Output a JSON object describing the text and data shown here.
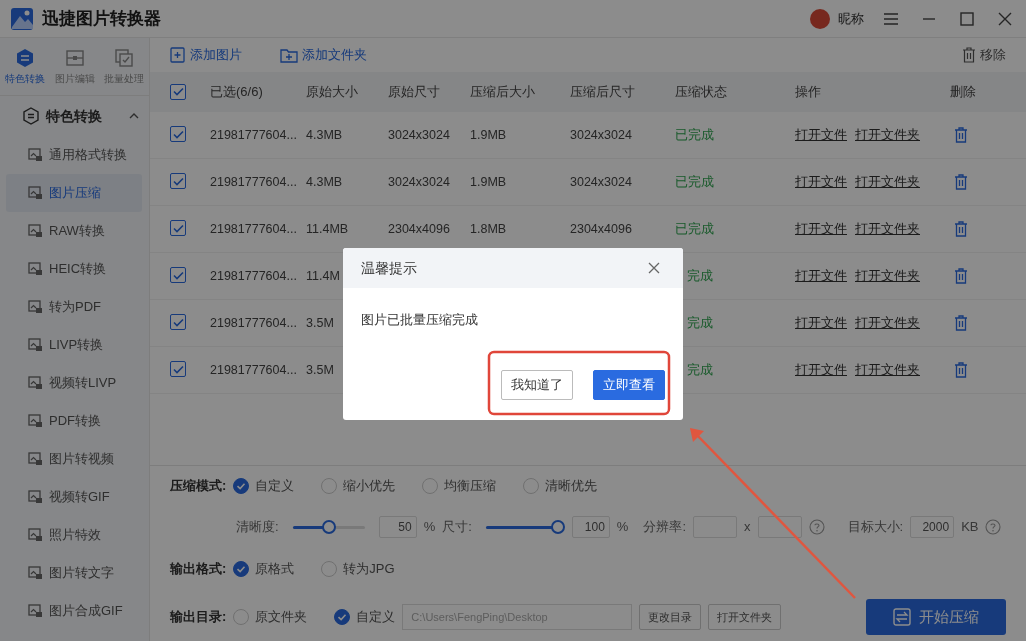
{
  "app": {
    "title": "迅捷图片转换器",
    "user": "昵称"
  },
  "top_tabs": [
    {
      "label": "特色转换",
      "selected": true
    },
    {
      "label": "图片编辑",
      "selected": false
    },
    {
      "label": "批量处理",
      "selected": false
    }
  ],
  "sidebar": {
    "group": {
      "label": "特色转换",
      "expanded": true
    },
    "items": [
      {
        "label": "通用格式转换",
        "selected": false
      },
      {
        "label": "图片压缩",
        "selected": true
      },
      {
        "label": "RAW转换",
        "selected": false
      },
      {
        "label": "HEIC转换",
        "selected": false
      },
      {
        "label": "转为PDF",
        "selected": false
      },
      {
        "label": "LIVP转换",
        "selected": false
      },
      {
        "label": "视频转LIVP",
        "selected": false
      },
      {
        "label": "PDF转换",
        "selected": false
      },
      {
        "label": "图片转视频",
        "selected": false
      },
      {
        "label": "视频转GIF",
        "selected": false
      },
      {
        "label": "照片特效",
        "selected": false
      },
      {
        "label": "图片转文字",
        "selected": false
      },
      {
        "label": "图片合成GIF",
        "selected": false
      }
    ]
  },
  "toolbar": {
    "add_image": "添加图片",
    "add_folder": "添加文件夹",
    "remove": "移除"
  },
  "table": {
    "all_checked": true,
    "columns": [
      "已选(6/6)",
      "原始大小",
      "原始尺寸",
      "压缩后大小",
      "压缩后尺寸",
      "压缩状态",
      "操作",
      "删除"
    ],
    "rows": [
      {
        "checked": true,
        "name": "21981777604...",
        "orig_size": "4.3MB",
        "orig_dim": "3024x3024",
        "new_size": "1.9MB",
        "new_dim": "3024x3024",
        "status": "已完成",
        "actions": [
          "打开文件",
          "打开文件夹"
        ]
      },
      {
        "checked": true,
        "name": "21981777604...",
        "orig_size": "4.3MB",
        "orig_dim": "3024x3024",
        "new_size": "1.9MB",
        "new_dim": "3024x3024",
        "status": "已完成",
        "actions": [
          "打开文件",
          "打开文件夹"
        ]
      },
      {
        "checked": true,
        "name": "21981777604...",
        "orig_size": "11.4MB",
        "orig_dim": "2304x4096",
        "new_size": "1.8MB",
        "new_dim": "2304x4096",
        "status": "已完成",
        "actions": [
          "打开文件",
          "打开文件夹"
        ]
      },
      {
        "checked": true,
        "name": "21981777604...",
        "orig_size": "11.4M",
        "status": "完成",
        "actions": [
          "打开文件",
          "打开文件夹"
        ]
      },
      {
        "checked": true,
        "name": "21981777604...",
        "orig_size": "3.5M",
        "status": "完成",
        "actions": [
          "打开文件",
          "打开文件夹"
        ]
      },
      {
        "checked": true,
        "name": "21981777604...",
        "orig_size": "3.5M",
        "status": "完成",
        "actions": [
          "打开文件",
          "打开文件夹"
        ]
      }
    ]
  },
  "settings": {
    "mode": {
      "label": "压缩模式:",
      "options": [
        {
          "label": "自定义",
          "selected": true
        },
        {
          "label": "缩小优先",
          "selected": false
        },
        {
          "label": "均衡压缩",
          "selected": false
        },
        {
          "label": "清晰优先",
          "selected": false
        }
      ]
    },
    "quality": {
      "label": "清晰度:",
      "level": 0.5,
      "value": "50",
      "unit": "%"
    },
    "size": {
      "label": "尺寸:",
      "level": 1,
      "value": "100",
      "unit": "%"
    },
    "resolution": {
      "label": "分辨率:",
      "separator": "x"
    },
    "target": {
      "label": "目标大小:",
      "value": "2000",
      "unit": "KB"
    },
    "format": {
      "label": "输出格式:",
      "options": [
        {
          "label": "原格式",
          "selected": true
        },
        {
          "label": "转为JPG",
          "selected": false
        }
      ]
    },
    "output": {
      "label": "输出目录:",
      "options": [
        {
          "label": "原文件夹",
          "selected": false
        },
        {
          "label": "自定义",
          "selected": true
        }
      ],
      "path": "C:\\Users\\FengPing\\Desktop",
      "change": "更改目录",
      "open": "打开文件夹"
    },
    "start": "开始压缩"
  },
  "dialog": {
    "title": "温馨提示",
    "message": "图片已批量压缩完成",
    "buttons": [
      {
        "label": "我知道了",
        "kind": "secondary"
      },
      {
        "label": "立即查看",
        "kind": "primary"
      }
    ]
  }
}
